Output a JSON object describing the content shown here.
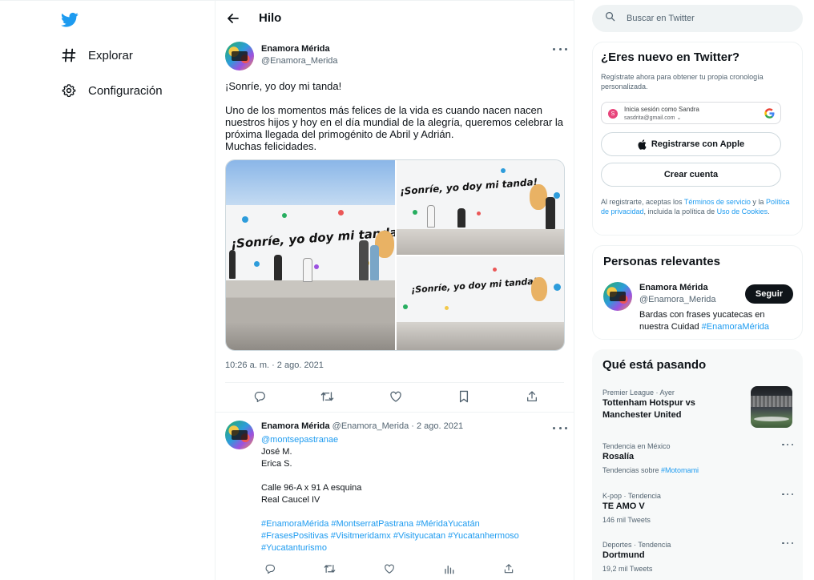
{
  "nav": {
    "logo_icon": "twitter-bird-icon",
    "brand_color": "#1d9bf0",
    "items": [
      {
        "icon": "hashtag-icon",
        "label": "Explorar"
      },
      {
        "icon": "gear-icon",
        "label": "Configuración"
      }
    ]
  },
  "thread": {
    "header_title": "Hilo",
    "main_tweet": {
      "author_name": "Enamora Mérida",
      "author_handle": "@Enamora_Merida",
      "text_lines": [
        "¡Sonríe, yo doy mi tanda!",
        "",
        "Uno de los momentos más felices de la vida es cuando nacen nacen",
        "nuestros hijos y hoy en el día mundial de la alegría, queremos celebrar la",
        "próxima llegada del primogénito de Abril y Adrián.",
        "Muchas felicidades."
      ],
      "mural_text": "¡Sonríe, yo doy mi tanda!",
      "timestamp": "10:26 a. m. · 2 ago. 2021",
      "actions": [
        "reply-icon",
        "retweet-icon",
        "like-icon",
        "bookmark-icon",
        "share-icon"
      ]
    },
    "reply": {
      "author_name": "Enamora Mérida",
      "meta": "@Enamora_Merida · 2 ago. 2021",
      "mention": "@montsepastranae",
      "lines": [
        "José M.",
        "Erica S.",
        "",
        "Calle 96-A x 91 A esquina",
        "Real Caucel IV",
        ""
      ],
      "hashtags_line1": "#EnamoraMérida #MontserratPastrana #MéridaYucatán",
      "hashtags_line2": "#FrasesPositivas #Visitmeridamx #Visityucatan #Yucatanhermoso",
      "hashtags_line3": "#Yucatanturismo",
      "actions": [
        "reply-icon",
        "retweet-icon",
        "like-icon",
        "analytics-icon",
        "share-icon"
      ]
    }
  },
  "sidebar": {
    "search_placeholder": "Buscar en Twitter",
    "new_to_twitter": {
      "title": "¿Eres nuevo en Twitter?",
      "subtext": "Regístrate ahora para obtener tu propia cronología personalizada.",
      "google_line1": "Inicia sesión como Sandra",
      "google_line2": "sasdrita@gmail.com",
      "google_avatar_letter": "S",
      "apple_label": "Registrarse con Apple",
      "create_label": "Crear cuenta",
      "legal_prefix": "Al registrarte, aceptas los ",
      "legal_terms": "Términos de servicio",
      "legal_mid1": " y la ",
      "legal_privacy": "Política de privacidad",
      "legal_mid2": ", incluida la política de ",
      "legal_cookies": "Uso de Cookies",
      "legal_end": "."
    },
    "relevant": {
      "title": "Personas relevantes",
      "name": "Enamora Mérida",
      "handle": "@Enamora_Merida",
      "bio": "Bardas con frases yucatecas en nuestra Cuidad ",
      "bio_tag": "#EnamoraMérida",
      "follow_label": "Seguir"
    },
    "trends": {
      "title": "Qué está pasando",
      "items": [
        {
          "meta": "Premier League · Ayer",
          "title": "Tottenham Hotspur vs Manchester United",
          "sub": "",
          "sub_tag": ""
        },
        {
          "meta": "Tendencia en México",
          "title": "Rosalía",
          "sub": "Tendencias sobre ",
          "sub_tag": "#Motomami"
        },
        {
          "meta": "K-pop · Tendencia",
          "title": "TE AMO V",
          "sub": "146 mil Tweets",
          "sub_tag": ""
        },
        {
          "meta": "Deportes · Tendencia",
          "title": "Dortmund",
          "sub": "19,2 mil Tweets",
          "sub_tag": ""
        }
      ]
    }
  }
}
